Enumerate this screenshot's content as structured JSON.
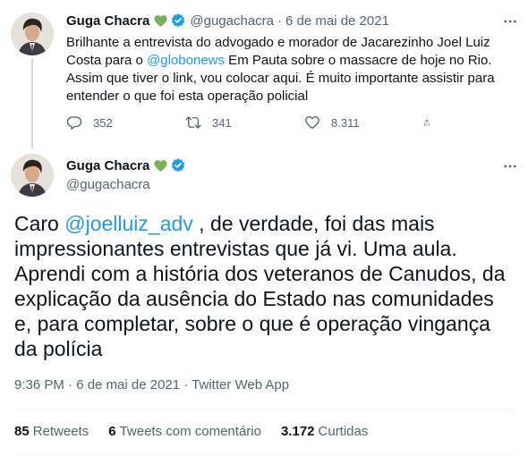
{
  "tweet1": {
    "name": "Guga Chacra",
    "handle": "@gugachacra",
    "separator": "·",
    "date": "6 de mai de 2021",
    "text_parts": {
      "a": "Brilhante a entrevista do advogado e morador de Jacarezinho Joel Luiz Costa para o ",
      "mention": "@globonews",
      "b": " Em Pauta sobre o massacre  de hoje no Rio. Assim que tiver o link, vou colocar aqui. É muito importante assistir para entender o que foi esta operação policial"
    },
    "actions": {
      "replies": "352",
      "retweets": "341",
      "likes": "8.311"
    }
  },
  "tweet2": {
    "name": "Guga Chacra",
    "handle": "@gugachacra",
    "text_parts": {
      "a": "Caro ",
      "mention": "@joelluiz_adv",
      "b": " , de verdade, foi das mais impressionantes entrevistas que já vi. Uma aula. Aprendi com a história dos veteranos de Canudos, da explicação da ausência do Estado nas comunidades e, para completar, sobre o que é operação vingança da polícia"
    },
    "timestamp": "9:36 PM · 6 de mai de 2021 · Twitter Web App",
    "stats": {
      "retweets_count": "85",
      "retweets_label": "Retweets",
      "quotes_count": "6",
      "quotes_label": "Tweets com comentário",
      "likes_count": "3.172",
      "likes_label": "Curtidas"
    }
  },
  "icons": {
    "heart_emoji": "green-heart-icon",
    "verified": "verified-badge-icon",
    "more": "more-icon",
    "reply": "reply-icon",
    "retweet": "retweet-icon",
    "like": "like-icon",
    "share": "share-icon"
  },
  "colors": {
    "accent": "#1d9bf0",
    "secondary_text": "#536471",
    "emoji_green": "#78b159",
    "thread_line": "#cfd9de"
  }
}
